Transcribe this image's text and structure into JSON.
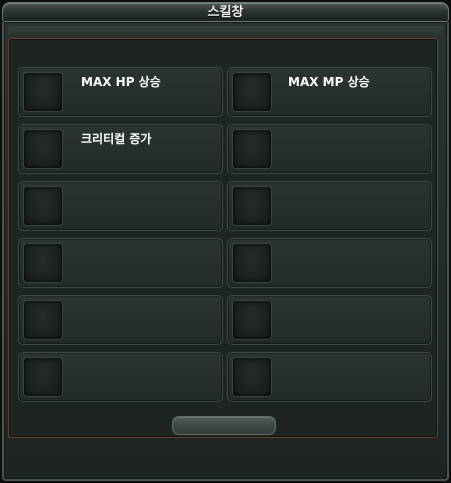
{
  "window": {
    "title": "스킬창"
  },
  "skill_slots": [
    {
      "label": "MAX HP 상승"
    },
    {
      "label": "MAX MP 상승"
    },
    {
      "label": "크리티컬 증가"
    },
    {
      "label": ""
    },
    {
      "label": ""
    },
    {
      "label": ""
    },
    {
      "label": ""
    },
    {
      "label": ""
    },
    {
      "label": ""
    },
    {
      "label": ""
    },
    {
      "label": ""
    },
    {
      "label": ""
    }
  ],
  "colors": {
    "panel_border_accent": "#6a3f2f",
    "text": "#ffffff"
  }
}
